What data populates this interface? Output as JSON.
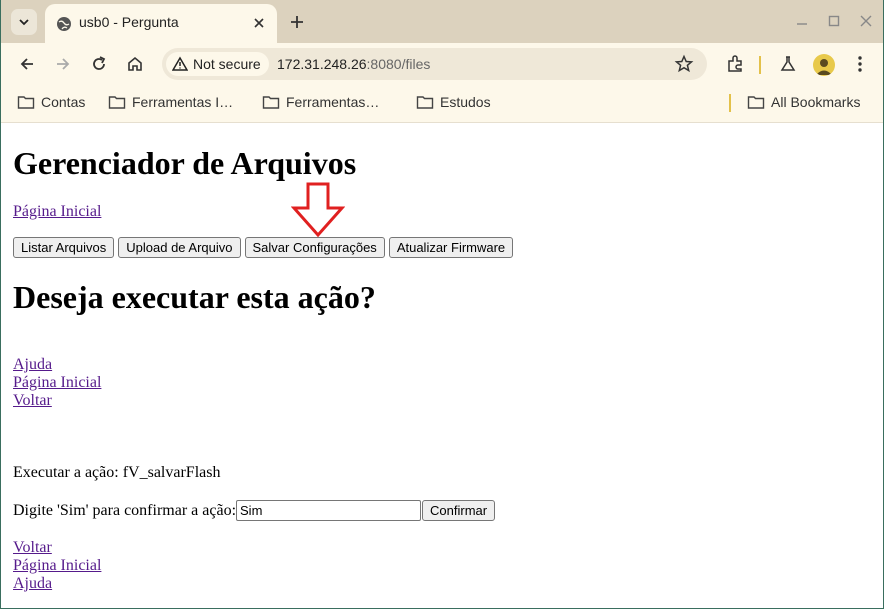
{
  "browser": {
    "tab_title": "usb0 - Pergunta",
    "not_secure": "Not secure",
    "url_host": "172.31.248.26",
    "url_rest": ":8080/files",
    "bookmarks": [
      {
        "label": "Contas"
      },
      {
        "label": "Ferramentas I…"
      },
      {
        "label": "Ferramentas…"
      },
      {
        "label": "Estudos"
      }
    ],
    "all_bookmarks": "All Bookmarks",
    "accent_color": "#dcd2be"
  },
  "page": {
    "title": "Gerenciador de Arquivos",
    "home_link": "Página Inicial",
    "buttons": [
      {
        "label": "Listar Arquivos"
      },
      {
        "label": "Upload de Arquivo"
      },
      {
        "label": "Salvar Configurações"
      },
      {
        "label": "Atualizar Firmware"
      }
    ],
    "question": "Deseja executar esta ação?",
    "links_top": [
      {
        "label": "Ajuda"
      },
      {
        "label": "Página Inicial"
      },
      {
        "label": "Voltar"
      }
    ],
    "action_text": "Executar a ação: fV_salvarFlash",
    "confirm_prompt": "Digite 'Sim' para confirmar a ação:",
    "confirm_value": "Sim",
    "confirm_button": "Confirmar",
    "links_bottom": [
      {
        "label": "Voltar"
      },
      {
        "label": "Página Inicial"
      },
      {
        "label": "Ajuda"
      }
    ],
    "link_color": "#551a8b",
    "annotation_arrow_color": "#e02020"
  }
}
